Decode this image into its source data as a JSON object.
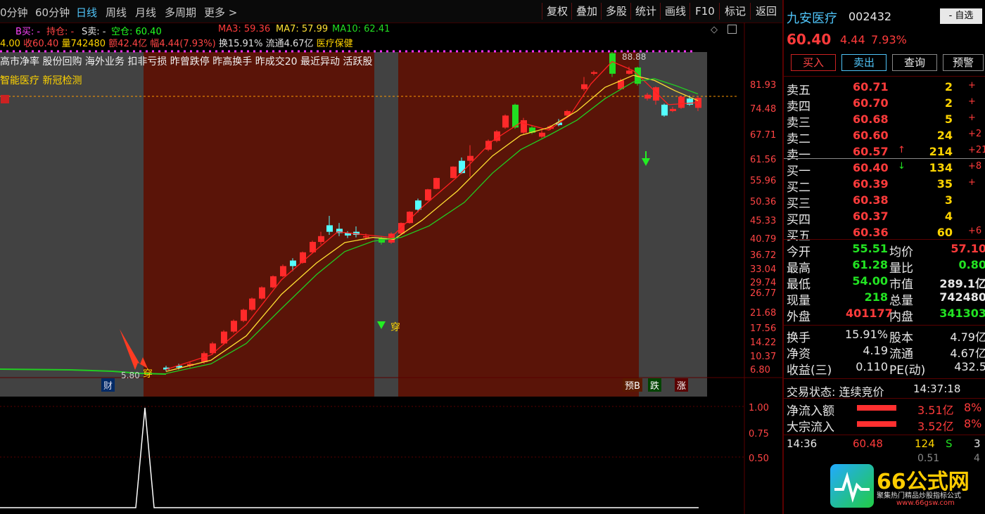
{
  "toolbar": {
    "periods": [
      "0分钟",
      "60分钟",
      "日线",
      "周线",
      "月线",
      "多周期",
      "更多 >"
    ],
    "buttons": [
      "复权",
      "叠加",
      "多股",
      "统计",
      "画线",
      "F10",
      "标记",
      "返回"
    ]
  },
  "info": {
    "signal_b": "B买: -",
    "signal_hold": "持仓: -",
    "signal_s": "S卖: -",
    "signal_empty": "空仓: 60.40",
    "ma3": "MA3: 59.36",
    "ma7": "MA7: 57.99",
    "ma10": "MA10: 62.41",
    "ohlc_prefix": "4.00",
    "close": "收60.40",
    "volume": "量742480",
    "amount": "额42.4亿",
    "change": "幅4.44(7.93%)",
    "turnover": "换15.91%",
    "float": "流通4.67亿",
    "sector": "医疗保健",
    "concepts_line1": "高市净率 股份回购 海外业务 扣非亏损 昨曾跌停 昨高换手 昨成交20 最近异动 活跃股",
    "concepts_line2": "智能医疗 新冠检测"
  },
  "chart": {
    "price_axis": [
      "81.93",
      "74.48",
      "67.71",
      "61.56",
      "55.96",
      "50.36",
      "45.33",
      "40.79",
      "36.72",
      "33.04",
      "29.74",
      "26.77",
      "21.68",
      "17.56",
      "14.22",
      "10.37",
      "6.80"
    ],
    "high_label": "88.88",
    "low_label": "5.80",
    "mark_cai": "财",
    "mark_chuan1": "穿",
    "mark_chuan2": "穿",
    "mark_yub": "预B",
    "mark_die": "跌",
    "mark_zhang": "涨",
    "sub_axis": [
      "1.00",
      "0.75",
      "0.50"
    ],
    "colors": {
      "up": "#ff2a2a",
      "down": "#54ffff",
      "big_down": "#22dd22",
      "ma3": "#ff2020",
      "ma7": "#ffe033",
      "ma10": "#22cc22"
    }
  },
  "chart_data": {
    "type": "candlestick",
    "ma_lines": [
      "MA3",
      "MA7",
      "MA10"
    ],
    "ylim": [
      5.8,
      88.88
    ],
    "high": 88.88,
    "low": 5.8,
    "last": 60.4
  },
  "panel": {
    "name": "九安医疗",
    "code": "002432",
    "self_select": "- 自选",
    "price": "60.40",
    "chg": "4.44",
    "pct": "7.93%",
    "actions": [
      "买入",
      "卖出",
      "查询",
      "预警"
    ],
    "asks": [
      {
        "label": "卖五",
        "price": "60.71",
        "vol": "2",
        "extra": "+"
      },
      {
        "label": "卖四",
        "price": "60.70",
        "vol": "2",
        "extra": "+"
      },
      {
        "label": "卖三",
        "price": "60.68",
        "vol": "5",
        "extra": "+"
      },
      {
        "label": "卖二",
        "price": "60.60",
        "vol": "24",
        "extra": "+2"
      },
      {
        "label": "卖一",
        "price": "60.57",
        "vol": "214",
        "extra": "+21"
      }
    ],
    "bids": [
      {
        "label": "买一",
        "price": "60.40",
        "vol": "134",
        "extra": "+8"
      },
      {
        "label": "买二",
        "price": "60.39",
        "vol": "35",
        "extra": "+"
      },
      {
        "label": "买三",
        "price": "60.38",
        "vol": "3",
        "extra": ""
      },
      {
        "label": "买四",
        "price": "60.37",
        "vol": "4",
        "extra": ""
      },
      {
        "label": "买五",
        "price": "60.36",
        "vol": "60",
        "extra": "+6"
      }
    ],
    "stats": [
      {
        "k1": "今开",
        "v1": "55.51",
        "k2": "均价",
        "v2": "57.10"
      },
      {
        "k1": "最高",
        "v1": "61.28",
        "k2": "量比",
        "v2": "0.80"
      },
      {
        "k1": "最低",
        "v1": "54.00",
        "k2": "市值",
        "v2": "289.1亿"
      },
      {
        "k1": "现量",
        "v1": "218",
        "k2": "总量",
        "v2": "742480"
      },
      {
        "k1": "外盘",
        "v1": "401177",
        "k2": "内盘",
        "v2": "341303"
      }
    ],
    "stats2": [
      {
        "k1": "换手",
        "v1": "15.91%",
        "k2": "股本",
        "v2": "4.79亿"
      },
      {
        "k1": "净资",
        "v1": "4.19",
        "k2": "流通",
        "v2": "4.67亿"
      },
      {
        "k1": "收益(三)",
        "v1": "0.110",
        "k2": "PE(动)",
        "v2": "432.5"
      }
    ],
    "trade_status": "交易状态: 连续竞价",
    "trade_time": "14:37:18",
    "flows": [
      {
        "label": "净流入额",
        "value": "3.51亿",
        "pct": "8%"
      },
      {
        "label": "大宗流入",
        "value": "3.52亿",
        "pct": "8%"
      }
    ],
    "tick": {
      "time": "14:36",
      "price": "60.48",
      "vol": "124",
      "side": "S",
      "extra": "3"
    },
    "tick2": {
      "price": "0.51",
      "extra": "4"
    }
  },
  "watermark": {
    "brand": "66公式网",
    "slogan": "聚集热门精品炒股指标公式",
    "url": "www.66gsw.com"
  }
}
